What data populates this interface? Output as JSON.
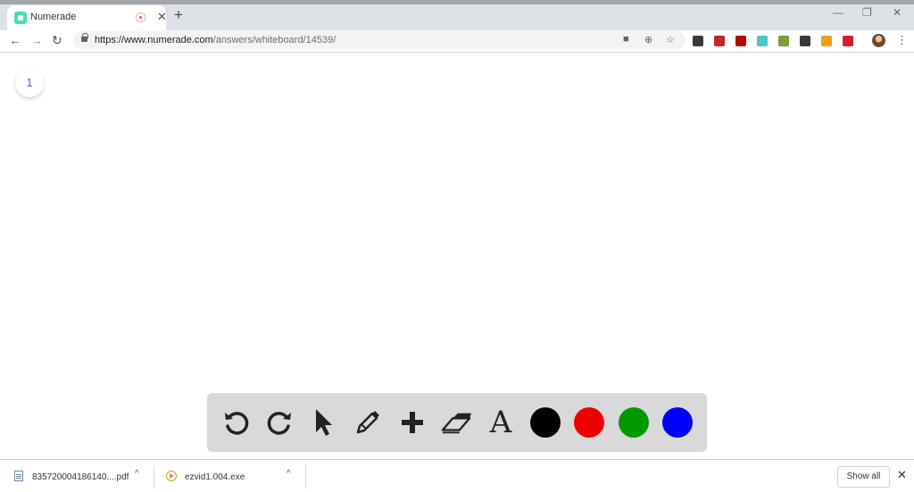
{
  "browser": {
    "tab_title": "Numerade",
    "tab_close": "✕",
    "new_tab": "+",
    "url_host": "https://www.numerade.com",
    "url_path": "/answers/whiteboard/14539/",
    "window_controls": {
      "minimize": "—",
      "restore": "❐",
      "close": "✕"
    },
    "nav": {
      "back": "←",
      "forward": "→",
      "reload": "↻"
    },
    "menu_glyph": "⋮",
    "extension_colors": [
      "#3b3b3b",
      "#c1272d",
      "#b30b00",
      "#4fc6c0",
      "#7d9c3a",
      "#3a3a3a",
      "#e8a317",
      "#d81e2c"
    ]
  },
  "page": {
    "page_number": "1",
    "toolbar": {
      "tools": [
        {
          "name": "undo-icon"
        },
        {
          "name": "redo-icon"
        },
        {
          "name": "pointer-icon"
        },
        {
          "name": "pencil-icon"
        },
        {
          "name": "plus-icon"
        },
        {
          "name": "eraser-icon"
        },
        {
          "name": "text-icon",
          "glyph": "A"
        }
      ],
      "colors": [
        "#000000",
        "#ee0000",
        "#009900",
        "#0000ff"
      ]
    }
  },
  "downloads": {
    "items": [
      {
        "filename": "835720004186140....pdf",
        "caret": "^"
      },
      {
        "filename": "ezvid1.004.exe",
        "caret": "^"
      }
    ],
    "show_all": "Show all",
    "close": "✕"
  }
}
